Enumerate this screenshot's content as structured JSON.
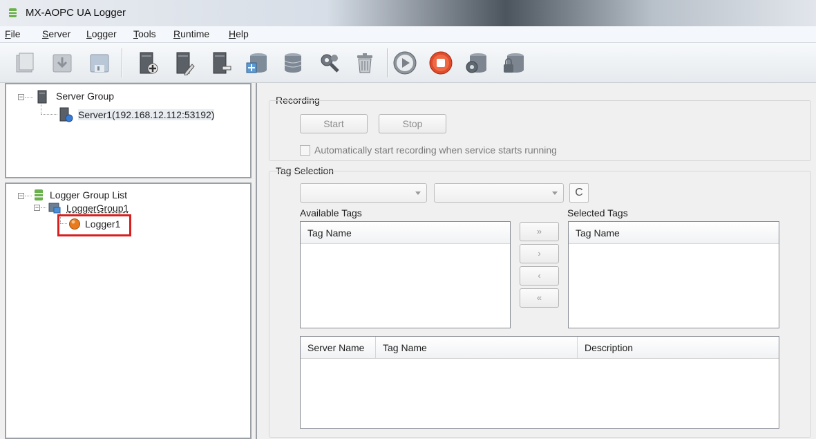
{
  "window": {
    "title": "MX-AOPC UA Logger"
  },
  "menu": [
    {
      "label": "File",
      "accel": "F",
      "rest": "ile"
    },
    {
      "label": "Server",
      "accel": "S",
      "rest": "erver"
    },
    {
      "label": "Logger",
      "accel": "L",
      "rest": "ogger"
    },
    {
      "label": "Tools",
      "accel": "T",
      "rest": "ools"
    },
    {
      "label": "Runtime",
      "accel": "R",
      "rest": "untime"
    },
    {
      "label": "Help",
      "accel": "H",
      "rest": "elp"
    }
  ],
  "toolbar": {
    "icons": [
      "new-document-icon",
      "import-icon",
      "save-icon",
      "add-server-icon",
      "edit-server-icon",
      "remove-server-icon",
      "add-logger-group-icon",
      "add-logger-icon",
      "settings-icon",
      "delete-icon",
      "start-icon",
      "stop-icon",
      "database-view-icon",
      "database-lock-icon"
    ]
  },
  "server_tree": {
    "root": "Server Group",
    "child": "Server1(192.168.12.112:53192)"
  },
  "logger_tree": {
    "root": "Logger Group List",
    "group": "LoggerGroup1",
    "logger": "Logger1"
  },
  "recording": {
    "title": "Recording",
    "start_label": "Start",
    "stop_label": "Stop",
    "auto_start_label": "Automatically start recording when service starts running",
    "auto_start_checked": false
  },
  "tag_selection": {
    "title": "Tag Selection",
    "server_combo_value": "",
    "group_combo_value": "",
    "refresh_symbol": "C",
    "available_title": "Available Tags",
    "selected_title": "Selected Tags",
    "tag_name_header": "Tag Name",
    "move_buttons": [
      "»",
      "›",
      "‹",
      "«"
    ],
    "detail_headers": [
      "Server Name",
      "Tag Name",
      "Description"
    ]
  },
  "colors": {
    "highlight": "#d81e1e",
    "accent_blue": "#3a6ea5",
    "start_green": "#3b9a3b",
    "stop_red": "#d33a2a"
  }
}
